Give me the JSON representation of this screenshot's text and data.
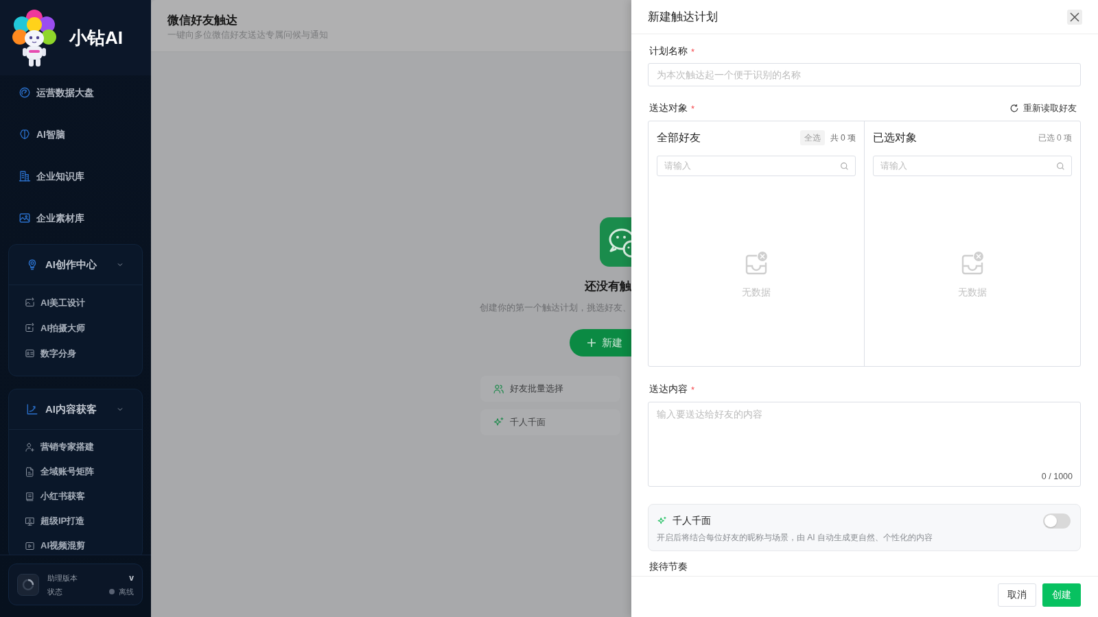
{
  "sidebar": {
    "brand": {
      "name": "小钻AI"
    },
    "nav_items": [
      {
        "label": "运营数据大盘"
      },
      {
        "label": "AI智脑"
      },
      {
        "label": "企业知识库"
      },
      {
        "label": "企业素材库"
      }
    ],
    "groups": [
      {
        "title": "AI创作中心",
        "expanded": true,
        "items": [
          {
            "label": "AI美工设计"
          },
          {
            "label": "AI拍摄大师"
          },
          {
            "label": "数字分身"
          }
        ]
      },
      {
        "title": "AI内容获客",
        "expanded": true,
        "items": [
          {
            "label": "营销专家搭建"
          },
          {
            "label": "全域账号矩阵"
          },
          {
            "label": "小红书获客"
          },
          {
            "label": "超级IP打造"
          },
          {
            "label": "AI视频混剪"
          }
        ]
      }
    ],
    "status_card": {
      "version_label": "助理版本",
      "version": "v",
      "status_label": "状态",
      "status": "离线",
      "online": false
    }
  },
  "page": {
    "title": "微信好友触达",
    "subtitle": "一键向多位微信好友送达专属问候与通知"
  },
  "empty_state": {
    "title": "还没有触",
    "description": "创建你的第一个触达计划，挑选好友、",
    "button": "新建",
    "features": [
      {
        "label": "好友批量选择",
        "kind": "friends"
      },
      {
        "label": "千人千面",
        "kind": "sparkle"
      }
    ]
  },
  "drawer": {
    "title": "新建触达计划",
    "plan_name": {
      "label": "计划名称",
      "required_mark": "*",
      "placeholder": "为本次触达起一个便于识别的名称"
    },
    "recipients": {
      "label": "送达对象",
      "required_mark": "*",
      "refresh": "重新读取好友",
      "source": {
        "title": "全部好友",
        "select_all": "全选",
        "count": "共 0 项",
        "search_placeholder": "请输入",
        "empty": "无数据"
      },
      "target": {
        "title": "已选对象",
        "count": "已选 0 项",
        "search_placeholder": "请输入",
        "empty": "无数据"
      }
    },
    "content": {
      "label": "送达内容",
      "required_mark": "*",
      "placeholder": "输入要送达给好友的内容",
      "counter": "0 / 1000"
    },
    "personalize": {
      "title": "千人千面",
      "description": "开启后将结合每位好友的昵称与场景，由 AI 自动生成更自然、个性化的内容",
      "on": false
    },
    "next_section": {
      "label": "接待节奏"
    },
    "buttons": [
      {
        "label": "取消",
        "kind": "secondary"
      },
      {
        "label": "创建",
        "kind": "primary"
      }
    ]
  }
}
